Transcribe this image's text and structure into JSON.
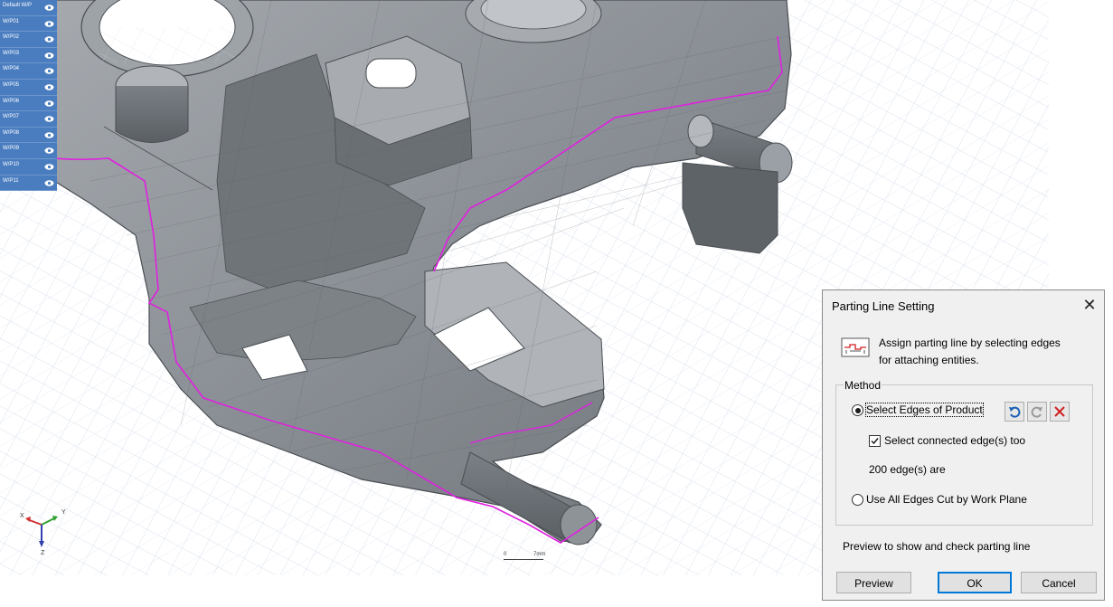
{
  "work_planes": {
    "items": [
      {
        "label": "Default W/P",
        "icon": "eye-icon"
      },
      {
        "label": "W/P01",
        "icon": "eye-icon"
      },
      {
        "label": "W/P02",
        "icon": "eye-icon"
      },
      {
        "label": "W/P03",
        "icon": "eye-icon"
      },
      {
        "label": "W/P04",
        "icon": "eye-icon"
      },
      {
        "label": "W/P05",
        "icon": "eye-icon"
      },
      {
        "label": "W/P06",
        "icon": "eye-icon"
      },
      {
        "label": "W/P07",
        "icon": "eye-icon"
      },
      {
        "label": "W/P08",
        "icon": "eye-icon"
      },
      {
        "label": "W/P09",
        "icon": "eye-icon"
      },
      {
        "label": "W/P10",
        "icon": "eye-icon"
      },
      {
        "label": "W/P11",
        "icon": "eye-icon"
      }
    ]
  },
  "viewport": {
    "scale_start": "0",
    "scale_end": "7mm",
    "triad": {
      "x_label": "X",
      "y_label": "Y",
      "z_label": "Z"
    },
    "parting_line_color": "#e020e0",
    "model_color": "#8f9499",
    "grid_color": "#c9d3e6"
  },
  "dialog": {
    "title": "Parting Line Setting",
    "close_icon": "close-icon",
    "description": "Assign parting line by selecting edges for attaching entities.",
    "description_line1": "Assign parting line by selecting edges",
    "description_line2": "for attaching entities.",
    "method_legend": "Method",
    "option_select_edges": "Select Edges of Product",
    "option_select_edges_selected": true,
    "undo_icon": "undo-icon",
    "redo_icon": "redo-icon",
    "delete_icon": "delete-x-icon",
    "checkbox_connected_label": "Select connected edge(s) too",
    "checkbox_connected_checked": true,
    "edge_count_text": "200 edge(s) are",
    "option_all_edges": "Use All Edges Cut by Work Plane",
    "option_all_edges_selected": false,
    "preview_hint": "Preview to show and check parting line",
    "preview_button": "Preview",
    "ok_button": "OK",
    "cancel_button": "Cancel",
    "accent_color": "#0078d7"
  }
}
